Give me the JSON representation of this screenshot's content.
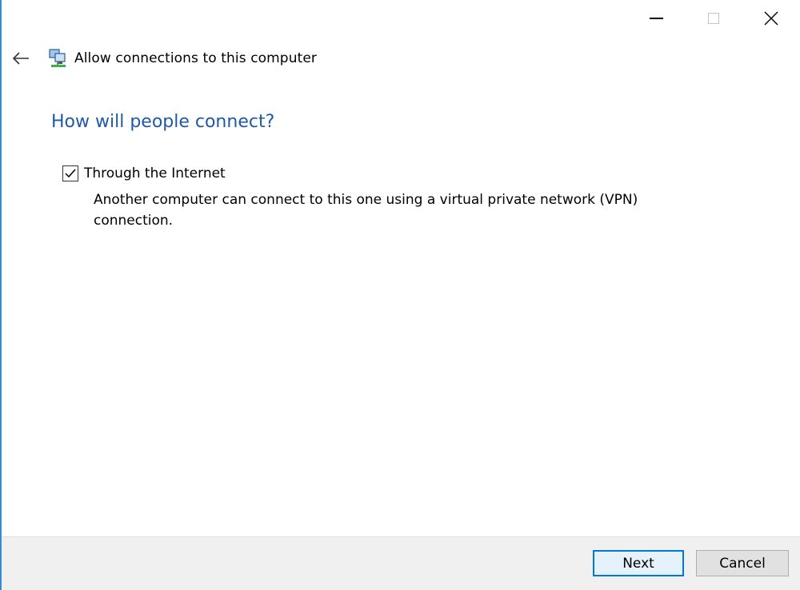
{
  "window": {
    "controls": {
      "minimize": "minimize-icon",
      "maximize": "maximize-icon",
      "close": "close-icon"
    }
  },
  "header": {
    "back_icon": "back-arrow-icon",
    "wizard_icon": "network-connection-icon",
    "title": "Allow connections to this computer"
  },
  "main": {
    "heading": "How will people connect?",
    "option": {
      "label": "Through the Internet",
      "checked": true,
      "description": "Another computer can connect to this one using a virtual private network (VPN) connection."
    }
  },
  "footer": {
    "next_label": "Next",
    "cancel_label": "Cancel"
  },
  "colors": {
    "heading": "#1e5aa8",
    "default_button_border": "#0078d7",
    "footer_bg": "#f0f0f0"
  }
}
